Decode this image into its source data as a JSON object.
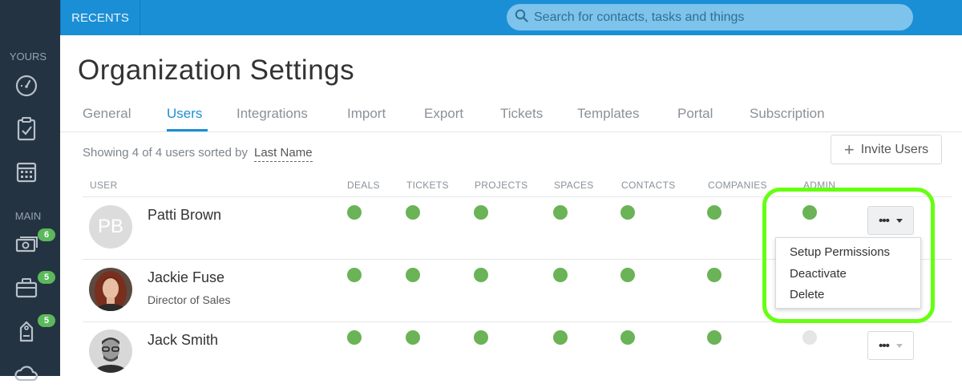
{
  "topbar": {
    "recents_label": "RECENTS",
    "search_placeholder": "Search for contacts, tasks and things"
  },
  "sidebar": {
    "section_yours": "YOURS",
    "section_main": "MAIN",
    "items": [
      {
        "icon": "dashboard-icon",
        "badge": ""
      },
      {
        "icon": "clipboard-check-icon",
        "badge": ""
      },
      {
        "icon": "calendar-icon",
        "badge": ""
      },
      {
        "icon": "money-icon",
        "badge": "6"
      },
      {
        "icon": "briefcase-icon",
        "badge": "5"
      },
      {
        "icon": "ticket-icon",
        "badge": "5"
      }
    ]
  },
  "page": {
    "title": "Organization Settings",
    "tabs": [
      "General",
      "Users",
      "Integrations",
      "Import",
      "Export",
      "Tickets",
      "Templates",
      "Portal",
      "Subscription"
    ],
    "active_tab": "Users"
  },
  "users_table": {
    "showing_text": "Showing 4 of 4 users sorted by",
    "sort_field": "Last Name",
    "invite_label": "Invite Users",
    "columns": [
      "USER",
      "DEALS",
      "TICKETS",
      "PROJECTS",
      "SPACES",
      "CONTACTS",
      "COMPANIES",
      "ADMIN"
    ],
    "rows": [
      {
        "name": "Patti Brown",
        "title": "",
        "initials": "PB",
        "deals": true,
        "tickets": true,
        "projects": true,
        "spaces": true,
        "contacts": true,
        "companies": true,
        "admin": true
      },
      {
        "name": "Jackie Fuse",
        "title": "Director of Sales",
        "initials": "",
        "deals": true,
        "tickets": true,
        "projects": true,
        "spaces": true,
        "contacts": true,
        "companies": true,
        "admin": null
      },
      {
        "name": "Jack Smith",
        "title": "",
        "initials": "",
        "deals": true,
        "tickets": true,
        "projects": true,
        "spaces": true,
        "contacts": true,
        "companies": true,
        "admin": false
      }
    ]
  },
  "row_menu": {
    "dots": "•••",
    "items": [
      "Setup Permissions",
      "Deactivate",
      "Delete"
    ]
  },
  "colors": {
    "topbar": "#1b8fd6",
    "sidebar": "#243341",
    "active_dot": "#6ab356",
    "inactive_dot": "#e5e5e5",
    "badge": "#5cb85c",
    "highlight": "#66ff11"
  }
}
